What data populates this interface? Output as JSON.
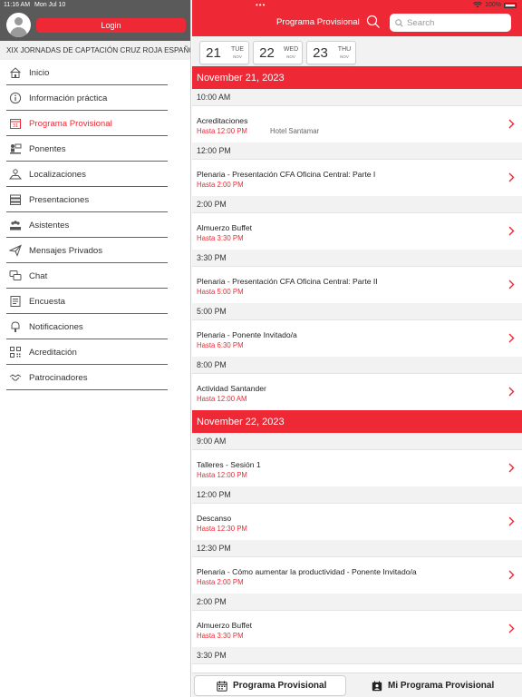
{
  "status": {
    "time": "11:16 AM",
    "date": "Mon Jul 10",
    "battery": "100%"
  },
  "sidebar": {
    "login_label": "Login",
    "org_name": "XIX JORNADAS DE CAPTACIÓN CRUZ ROJA ESPAÑOLA",
    "items": [
      {
        "label": "Inicio",
        "icon": "home-icon"
      },
      {
        "label": "Información práctica",
        "icon": "info-icon"
      },
      {
        "label": "Programa Provisional",
        "icon": "calendar-icon",
        "active": true
      },
      {
        "label": "Ponentes",
        "icon": "speaker-icon"
      },
      {
        "label": "Localizaciones",
        "icon": "location-icon"
      },
      {
        "label": "Presentaciones",
        "icon": "presentation-icon"
      },
      {
        "label": "Asistentes",
        "icon": "attendees-icon"
      },
      {
        "label": "Mensajes Privados",
        "icon": "paper-plane-icon"
      },
      {
        "label": "Chat",
        "icon": "chat-icon"
      },
      {
        "label": "Encuesta",
        "icon": "survey-icon"
      },
      {
        "label": "Notificaciones",
        "icon": "notification-icon"
      },
      {
        "label": "Acreditación",
        "icon": "qr-icon"
      },
      {
        "label": "Patrocinadores",
        "icon": "handshake-icon"
      }
    ]
  },
  "header": {
    "title": "Programa Provisional",
    "search_placeholder": "Search"
  },
  "dates": [
    {
      "num": "21",
      "day": "TUE",
      "month": "NOV"
    },
    {
      "num": "22",
      "day": "WED",
      "month": "NOV"
    },
    {
      "num": "23",
      "day": "THU",
      "month": "NOV"
    }
  ],
  "schedule": [
    {
      "type": "day",
      "label": "November 21, 2023"
    },
    {
      "type": "time",
      "label": "10:00 AM"
    },
    {
      "type": "session",
      "title": "Acreditaciones",
      "until": "Hasta 12:00 PM",
      "location": "Hotel Santamar"
    },
    {
      "type": "time",
      "label": "12:00 PM"
    },
    {
      "type": "session",
      "title": "Plenaria - Presentación CFA Oficina Central: Parte I",
      "until": "Hasta 2:00 PM"
    },
    {
      "type": "time",
      "label": "2:00 PM"
    },
    {
      "type": "session",
      "title": "Almuerzo Buffet",
      "until": "Hasta 3:30 PM"
    },
    {
      "type": "time",
      "label": "3:30 PM"
    },
    {
      "type": "session",
      "title": "Plenaria - Presentación CFA Oficina Central: Parte II",
      "until": "Hasta 5:00 PM"
    },
    {
      "type": "time",
      "label": "5:00 PM"
    },
    {
      "type": "session",
      "title": "Plenaria - Ponente Invitado/a",
      "until": "Hasta 6:30 PM"
    },
    {
      "type": "time",
      "label": "8:00 PM"
    },
    {
      "type": "session",
      "title": "Actividad Santander",
      "until": "Hasta 12:00 AM"
    },
    {
      "type": "day",
      "label": "November 22, 2023"
    },
    {
      "type": "time",
      "label": "9:00 AM"
    },
    {
      "type": "session",
      "title": "Talleres - Sesión 1",
      "until": "Hasta 12:00 PM"
    },
    {
      "type": "time",
      "label": "12:00 PM"
    },
    {
      "type": "session",
      "title": "Descanso",
      "until": "Hasta 12:30 PM"
    },
    {
      "type": "time",
      "label": "12:30 PM"
    },
    {
      "type": "session",
      "title": "Plenaria - Cómo aumentar la productividad - Ponente Invitado/a",
      "until": "Hasta 2:00 PM"
    },
    {
      "type": "time",
      "label": "2:00 PM"
    },
    {
      "type": "session",
      "title": "Almuerzo Buffet",
      "until": "Hasta 3:30 PM"
    },
    {
      "type": "time",
      "label": "3:30 PM"
    }
  ],
  "tabs": {
    "program": "Programa Provisional",
    "my_program": "Mi Programa Provisional"
  },
  "colors": {
    "accent": "#ee2935",
    "header_gray": "#5a5a5a"
  }
}
